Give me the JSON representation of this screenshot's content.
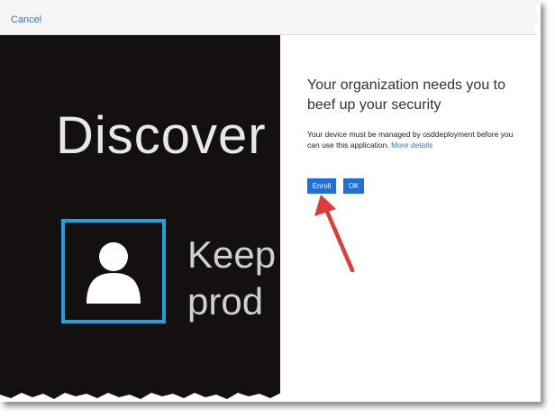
{
  "topbar": {
    "cancel_label": "Cancel"
  },
  "background": {
    "title": "Discover",
    "line1": "Keep",
    "line2": "prod",
    "avatar_icon": "person-icon",
    "accent_color": "#1aa3dc",
    "panel_color": "#151010"
  },
  "dialog": {
    "heading": "Your organization needs you to beef up your security",
    "body": "Your device must be managed by osddeployment before you can use this application.",
    "more_details_link": "More details",
    "enroll_label": "Enroll",
    "ok_label": "OK",
    "button_color": "#1e6fd9",
    "link_color": "#2b78d8"
  },
  "annotation": {
    "arrow_icon": "red-arrow-icon",
    "arrow_color": "#e03a3a"
  }
}
